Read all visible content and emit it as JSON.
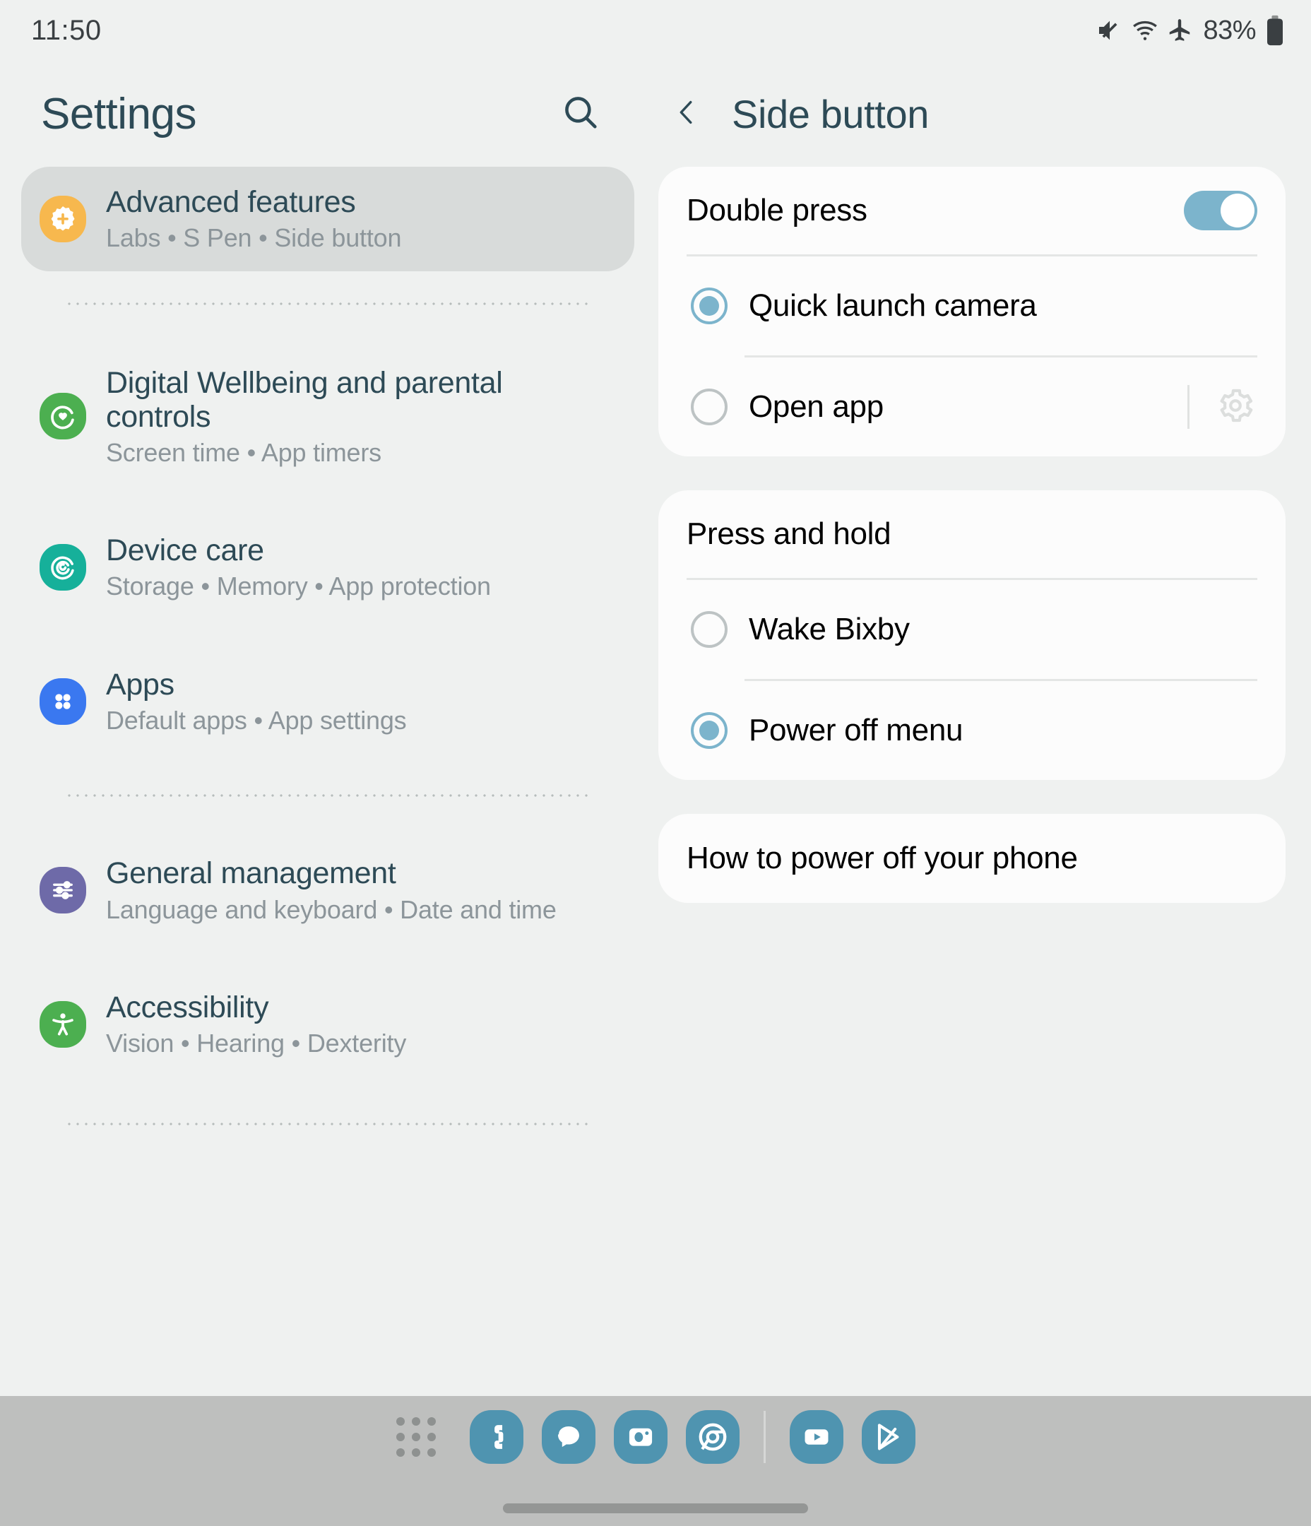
{
  "status_bar": {
    "time": "11:50",
    "battery_percent": "83%",
    "icons": [
      "mute-icon",
      "wifi-icon",
      "airplane-mode-icon",
      "battery-icon"
    ]
  },
  "colors": {
    "background": "#eff1f0",
    "card": "#fcfcfc",
    "heading": "#2d4a56",
    "subtitle": "#8c959a",
    "accent_toggle": "#7cb4cc",
    "selected_row": "#d8dbda",
    "dock_background": "#bebfbe",
    "dock_icon": "#4f94b0"
  },
  "sidebar": {
    "title": "Settings",
    "search_icon": "search-icon",
    "items": [
      {
        "label": "Advanced features",
        "summary": "Labs  •  S Pen  •  Side button",
        "icon": "advanced-features-icon",
        "icon_color": "#f7b84e",
        "selected": true
      },
      {
        "label": "Digital Wellbeing and parental controls",
        "summary": "Screen time  •  App timers",
        "icon": "digital-wellbeing-icon",
        "icon_color": "#4caf50",
        "selected": false
      },
      {
        "label": "Device care",
        "summary": "Storage  •  Memory  •  App protection",
        "icon": "device-care-icon",
        "icon_color": "#16b09a",
        "selected": false
      },
      {
        "label": "Apps",
        "summary": "Default apps  •  App settings",
        "icon": "apps-icon",
        "icon_color": "#3a78f0",
        "selected": false
      },
      {
        "label": "General management",
        "summary": "Language and keyboard  •  Date and time",
        "icon": "general-management-icon",
        "icon_color": "#6e6aa8",
        "selected": false
      },
      {
        "label": "Accessibility",
        "summary": "Vision  •  Hearing  •  Dexterity",
        "icon": "accessibility-icon",
        "icon_color": "#4caf50",
        "selected": false
      }
    ]
  },
  "detail": {
    "back_icon": "back-chevron-icon",
    "title": "Side button",
    "double_press": {
      "label": "Double press",
      "toggle_on": true,
      "options": [
        {
          "label": "Quick launch camera",
          "selected": true,
          "has_settings": false
        },
        {
          "label": "Open app",
          "selected": false,
          "has_settings": true,
          "settings_icon": "gear-icon"
        }
      ]
    },
    "press_and_hold": {
      "label": "Press and hold",
      "options": [
        {
          "label": "Wake Bixby",
          "selected": false
        },
        {
          "label": "Power off menu",
          "selected": true
        }
      ]
    },
    "help_link": "How to power off your phone"
  },
  "dock": {
    "apps_grid_icon": "app-grid-icon",
    "items": [
      {
        "name": "phone-icon",
        "label": "Phone"
      },
      {
        "name": "messages-icon",
        "label": "Messages"
      },
      {
        "name": "camera-icon",
        "label": "Camera"
      },
      {
        "name": "chrome-icon",
        "label": "Chrome"
      }
    ],
    "recent_items": [
      {
        "name": "youtube-icon",
        "label": "YouTube"
      },
      {
        "name": "play-store-icon",
        "label": "Play Store"
      }
    ],
    "home_indicator": "home-indicator"
  }
}
